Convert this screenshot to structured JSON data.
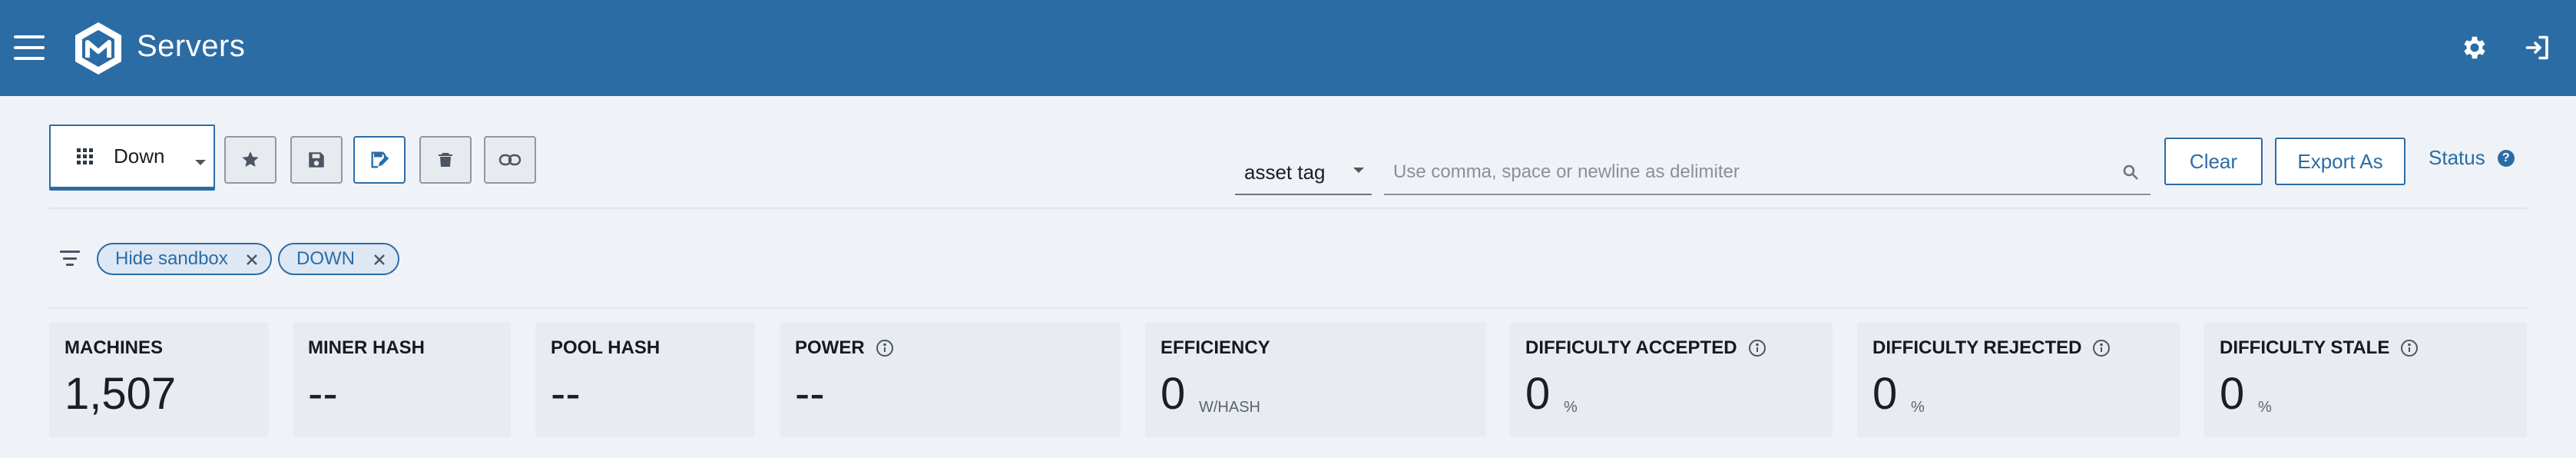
{
  "header": {
    "title": "Servers",
    "menu_icon": "hamburger-menu-icon",
    "logo_icon": "cube-logo-icon",
    "settings_icon": "gear-icon",
    "logout_icon": "logout-icon",
    "background": "#2c6ca5"
  },
  "toolbar": {
    "view_select": {
      "value": "Down",
      "icon": "grid-icon"
    },
    "buttons": [
      {
        "name": "favorite",
        "icon": "star-icon"
      },
      {
        "name": "save",
        "icon": "save-icon"
      },
      {
        "name": "save-as",
        "icon": "edit-save-icon"
      },
      {
        "name": "delete",
        "icon": "trash-icon"
      },
      {
        "name": "link",
        "icon": "link-icon"
      }
    ],
    "field_select": {
      "value": "asset tag"
    },
    "search": {
      "placeholder": "Use comma, space or newline as delimiter",
      "value": ""
    },
    "clear_label": "Clear",
    "export_label": "Export As",
    "status_label": "Status",
    "status_help": "?"
  },
  "filters": {
    "chips": [
      {
        "label": "Hide sandbox"
      },
      {
        "label": "DOWN"
      }
    ]
  },
  "stats": [
    {
      "title": "MACHINES",
      "value": "1,507",
      "unit": "",
      "info": false
    },
    {
      "title": "MINER HASH",
      "value": "--",
      "unit": "",
      "info": false
    },
    {
      "title": "POOL HASH",
      "value": "--",
      "unit": "",
      "info": false
    },
    {
      "title": "POWER",
      "value": "--",
      "unit": "",
      "info": true
    },
    {
      "title": "EFFICIENCY",
      "value": "0",
      "unit": "W/HASH",
      "info": false
    },
    {
      "title": "DIFFICULTY ACCEPTED",
      "value": "0",
      "unit": "%",
      "info": true
    },
    {
      "title": "DIFFICULTY REJECTED",
      "value": "0",
      "unit": "%",
      "info": true
    },
    {
      "title": "DIFFICULTY STALE",
      "value": "0",
      "unit": "%",
      "info": true
    }
  ],
  "colors": {
    "accent": "#2c6ca5",
    "page_bg": "#eff3f7",
    "card_bg": "#e8ecf1"
  }
}
